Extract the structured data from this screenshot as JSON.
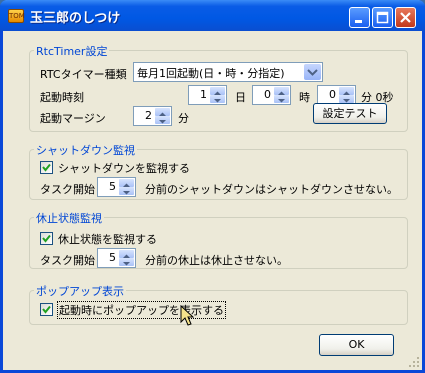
{
  "window": {
    "title": "玉三郎のしつけ",
    "app_icon_text": "TOM"
  },
  "rtc_group": {
    "title": "RtcTimer設定",
    "type_label": "RTCタイマー種類",
    "type_value": "毎月1回起動(日・時・分指定)",
    "time_label": "起動時刻",
    "day_value": "1",
    "day_unit": "日",
    "hour_value": "0",
    "hour_unit": "時",
    "minute_value": "0",
    "minute_unit": "分 0秒",
    "margin_label": "起動マージン",
    "margin_value": "2",
    "margin_unit": "分",
    "test_button": "設定テスト"
  },
  "shutdown_group": {
    "title": "シャットダウン監視",
    "checkbox_label": "シャットダウンを監視する",
    "checked": true,
    "start_label": "タスク開始",
    "start_value": "5",
    "start_suffix": "分前のシャットダウンはシャットダウンさせない。"
  },
  "sleep_group": {
    "title": "休止状態監視",
    "checkbox_label": "休止状態を監視する",
    "checked": true,
    "start_label": "タスク開始",
    "start_value": "5",
    "start_suffix": "分前の休止は休止させない。"
  },
  "popup_group": {
    "title": "ポップアップ表示",
    "checkbox_label": "起動時にポップアップを表示する",
    "checked": true
  },
  "footer": {
    "ok_button": "OK"
  },
  "colors": {
    "title_bar": "#0058e4",
    "group_title": "#0046d5",
    "dialog_bg": "#ece9d8",
    "checkmark": "#21a121"
  }
}
